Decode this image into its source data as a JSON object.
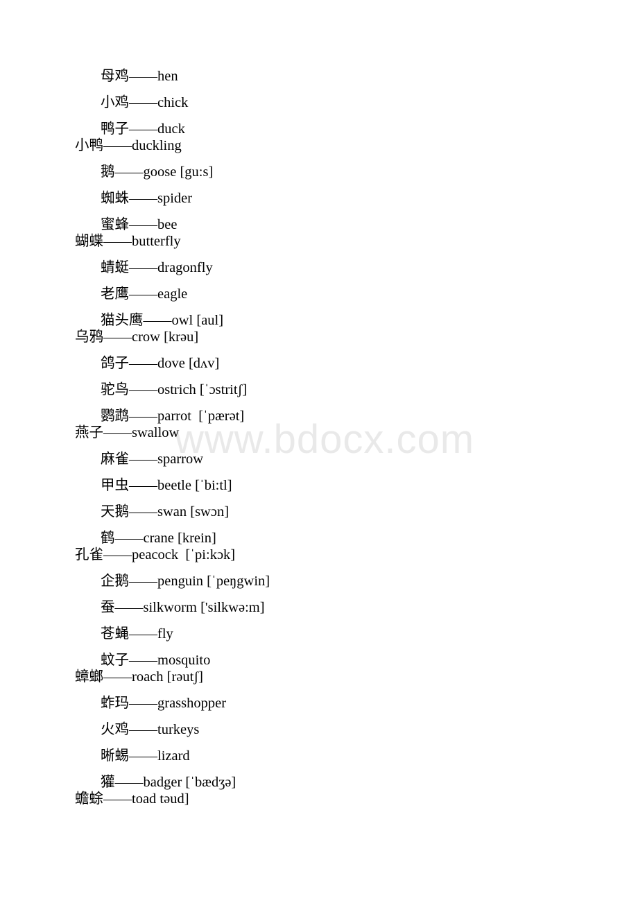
{
  "watermark": {
    "text": "www.bdocx.com",
    "color": "#e9e9e9"
  },
  "document": {
    "background_color": "#ffffff",
    "text_color": "#000000",
    "separator": "——",
    "entries": [
      {
        "line1": "母鸡——hen"
      },
      {
        "line1": "小鸡——chick"
      },
      {
        "line1": "鸭子——duck",
        "line2": "小鸭——duckling"
      },
      {
        "line1": "鹅——goose [gu:s]"
      },
      {
        "line1": "蜘蛛——spider"
      },
      {
        "line1": "蜜蜂——bee",
        "line2": "蝴蝶——butterfly"
      },
      {
        "line1": "蜻蜓——dragonfly"
      },
      {
        "line1": "老鹰——eagle"
      },
      {
        "line1": "猫头鹰——owl [aul]",
        "line2": "乌鸦——crow [krəu]"
      },
      {
        "line1": "鸽子——dove [dʌv]"
      },
      {
        "line1": "驼鸟——ostrich [ˈɔstritʃ]"
      },
      {
        "line1": "鹦鹉——parrot  [ˈpærət]",
        "line2": "燕子——swallow"
      },
      {
        "line1": "麻雀——sparrow"
      },
      {
        "line1": "甲虫——beetle [ˈbi:tl]"
      },
      {
        "line1": "天鹅——swan [swɔn]"
      },
      {
        "line1": "鹤——crane [krein]",
        "line2": "孔雀——peacock  [ˈpi:kɔk]"
      },
      {
        "line1": "企鹅——penguin [ˈpeŋgwin]"
      },
      {
        "line1": "蚕——silkworm ['silkwə:m]"
      },
      {
        "line1": "苍蝇——fly"
      },
      {
        "line1": "蚊子——mosquito",
        "line2": "蟑螂——roach [rəutʃ]"
      },
      {
        "line1": "蚱玛——grasshopper"
      },
      {
        "line1": "火鸡——turkeys"
      },
      {
        "line1": "晰蜴——lizard"
      },
      {
        "line1": "獾——badger [ˈbædʒə]",
        "line2": "蟾蜍——toad təud]"
      }
    ]
  }
}
